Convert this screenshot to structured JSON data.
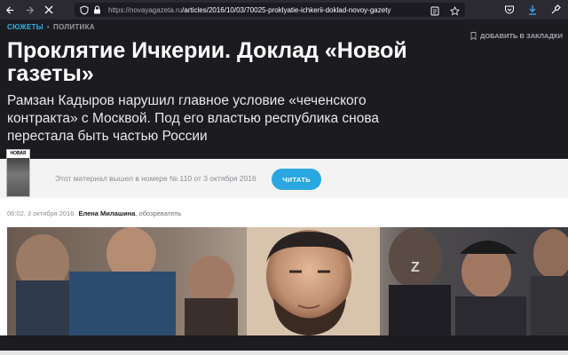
{
  "browser": {
    "url_host": "https://novayagazeta.ru",
    "url_path": "/articles/2016/10/03/70025-proklyatie-ichkerii-doklad-novoy-gazety"
  },
  "article": {
    "rubric_primary": "СЮЖЕТЫ",
    "rubric_secondary": "ПОЛИТИКА",
    "bookmark_label": "ДОБАВИТЬ В ЗАКЛАДКИ",
    "title": "Проклятие Ичкерии. Доклад «Новой газеты»",
    "lead": "Рамзан Кадыров нарушил главное условие «чеченского контракта» с Москвой. Под его властью республика снова перестала быть частью России",
    "issue_note": "Этот материал вышел в номере № 110 от 3 октября 2016",
    "read_button": "ЧИТАТЬ",
    "published": "06:02, 3 октября 2016",
    "author": "Елена Милашина",
    "author_role": ", обозреватель"
  },
  "cover": {
    "masthead": "НОВАЯ"
  },
  "colors": {
    "accent": "#2aa6e0",
    "rubric": "#36b3e6",
    "background_dark": "#1b1b20"
  }
}
